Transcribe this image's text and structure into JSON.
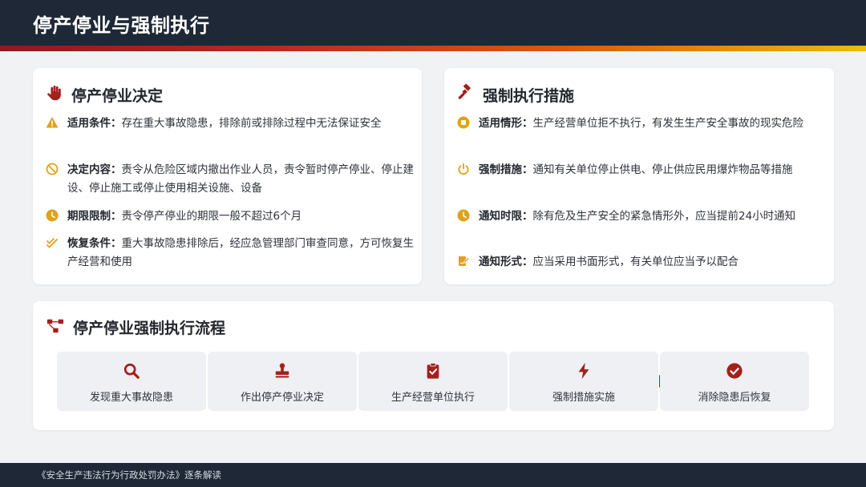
{
  "header": {
    "title": "停产停业与强制执行"
  },
  "left_card": {
    "title": "停产停业决定",
    "title_icon": "hand-stop-icon",
    "items": [
      {
        "label": "适用条件：",
        "text": "存在重大事故隐患，排除前或排除过程中无法保证安全",
        "icon": "warning-icon"
      },
      {
        "label": "决定内容：",
        "text": "责令从危险区域内撤出作业人员，责令暂时停产停业、停止建设、停止施工或停止使用相关设施、设备",
        "icon": "ban-icon"
      },
      {
        "label": "期限限制：",
        "text": "责令停产停业的期限一般不超过6个月",
        "icon": "clock-icon"
      },
      {
        "label": "恢复条件：",
        "text": "重大事故隐患排除后，经应急管理部门审查同意，方可恢复生产经营和使用",
        "icon": "double-check-icon"
      }
    ]
  },
  "right_card": {
    "title": "强制执行措施",
    "title_icon": "gavel-icon",
    "items": [
      {
        "label": "适用情形：",
        "text": "生产经营单位拒不执行，有发生生产安全事故的现实危险",
        "icon": "stop-circle-icon"
      },
      {
        "label": "强制措施：",
        "text": "通知有关单位停止供电、停止供应民用爆炸物品等措施",
        "icon": "power-icon"
      },
      {
        "label": "通知时限：",
        "text": "除有危及生产安全的紧急情形外，应当提前24小时通知",
        "icon": "clock-icon"
      },
      {
        "label": "通知形式：",
        "text": "应当采用书面形式，有关单位应当予以配合",
        "icon": "signature-icon"
      }
    ]
  },
  "flow": {
    "title": "停产停业强制执行流程",
    "title_icon": "sitemap-icon",
    "steps": [
      {
        "label": "发现重大事故隐患",
        "icon": "search-icon"
      },
      {
        "label": "作出停产停业决定",
        "icon": "stamp-icon"
      },
      {
        "label": "生产经营单位执行",
        "icon": "clipboard-check-icon"
      },
      {
        "label": "强制措施实施",
        "icon": "bolt-icon"
      },
      {
        "label": "消除隐患后恢复",
        "icon": "check-circle-icon"
      }
    ]
  },
  "footer": {
    "text": "《安全生产违法行为行政处罚办法》逐条解读"
  },
  "colors": {
    "accent_red": "#a3201c",
    "accent_gold": "#e0a21a",
    "dark_navy": "#1e2836"
  }
}
